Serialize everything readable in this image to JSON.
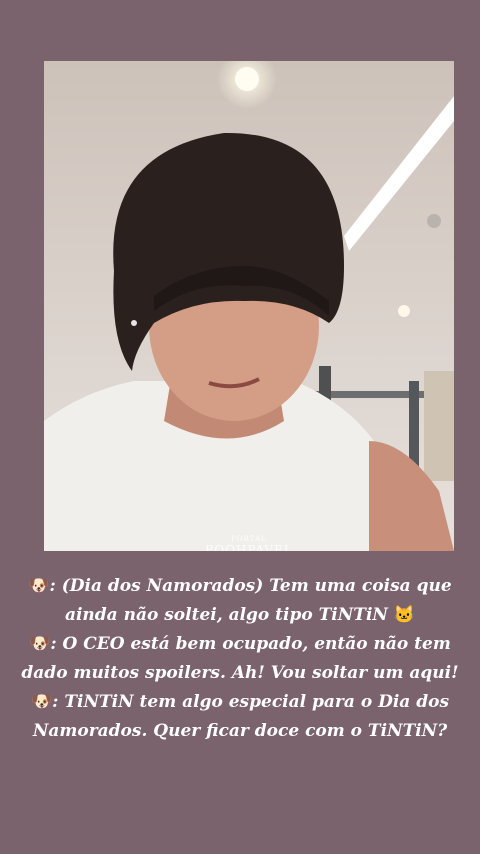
{
  "watermark": {
    "top": "PORTAL",
    "name": "POOHPAVEL"
  },
  "caption": {
    "lines": [
      {
        "icon": "🐶",
        "text": ": (Dia dos Namorados) Tem uma coisa que"
      },
      {
        "text": "ainda não soltei, algo tipo TiNTiN",
        "trail_icon": "🐱"
      },
      {
        "icon": "🐶",
        "text": ": O CEO está bem ocupado, então não tem"
      },
      {
        "text": "dado muitos spoilers. Ah! Vou soltar um aqui!"
      },
      {
        "icon": "🐶",
        "text": ": TiNTiN tem algo especial para o Dia dos"
      },
      {
        "text": "Namorados. Quer ficar doce com o TiNTiN?"
      }
    ]
  },
  "colors": {
    "background": "#7a636c",
    "text": "#ffffff"
  }
}
